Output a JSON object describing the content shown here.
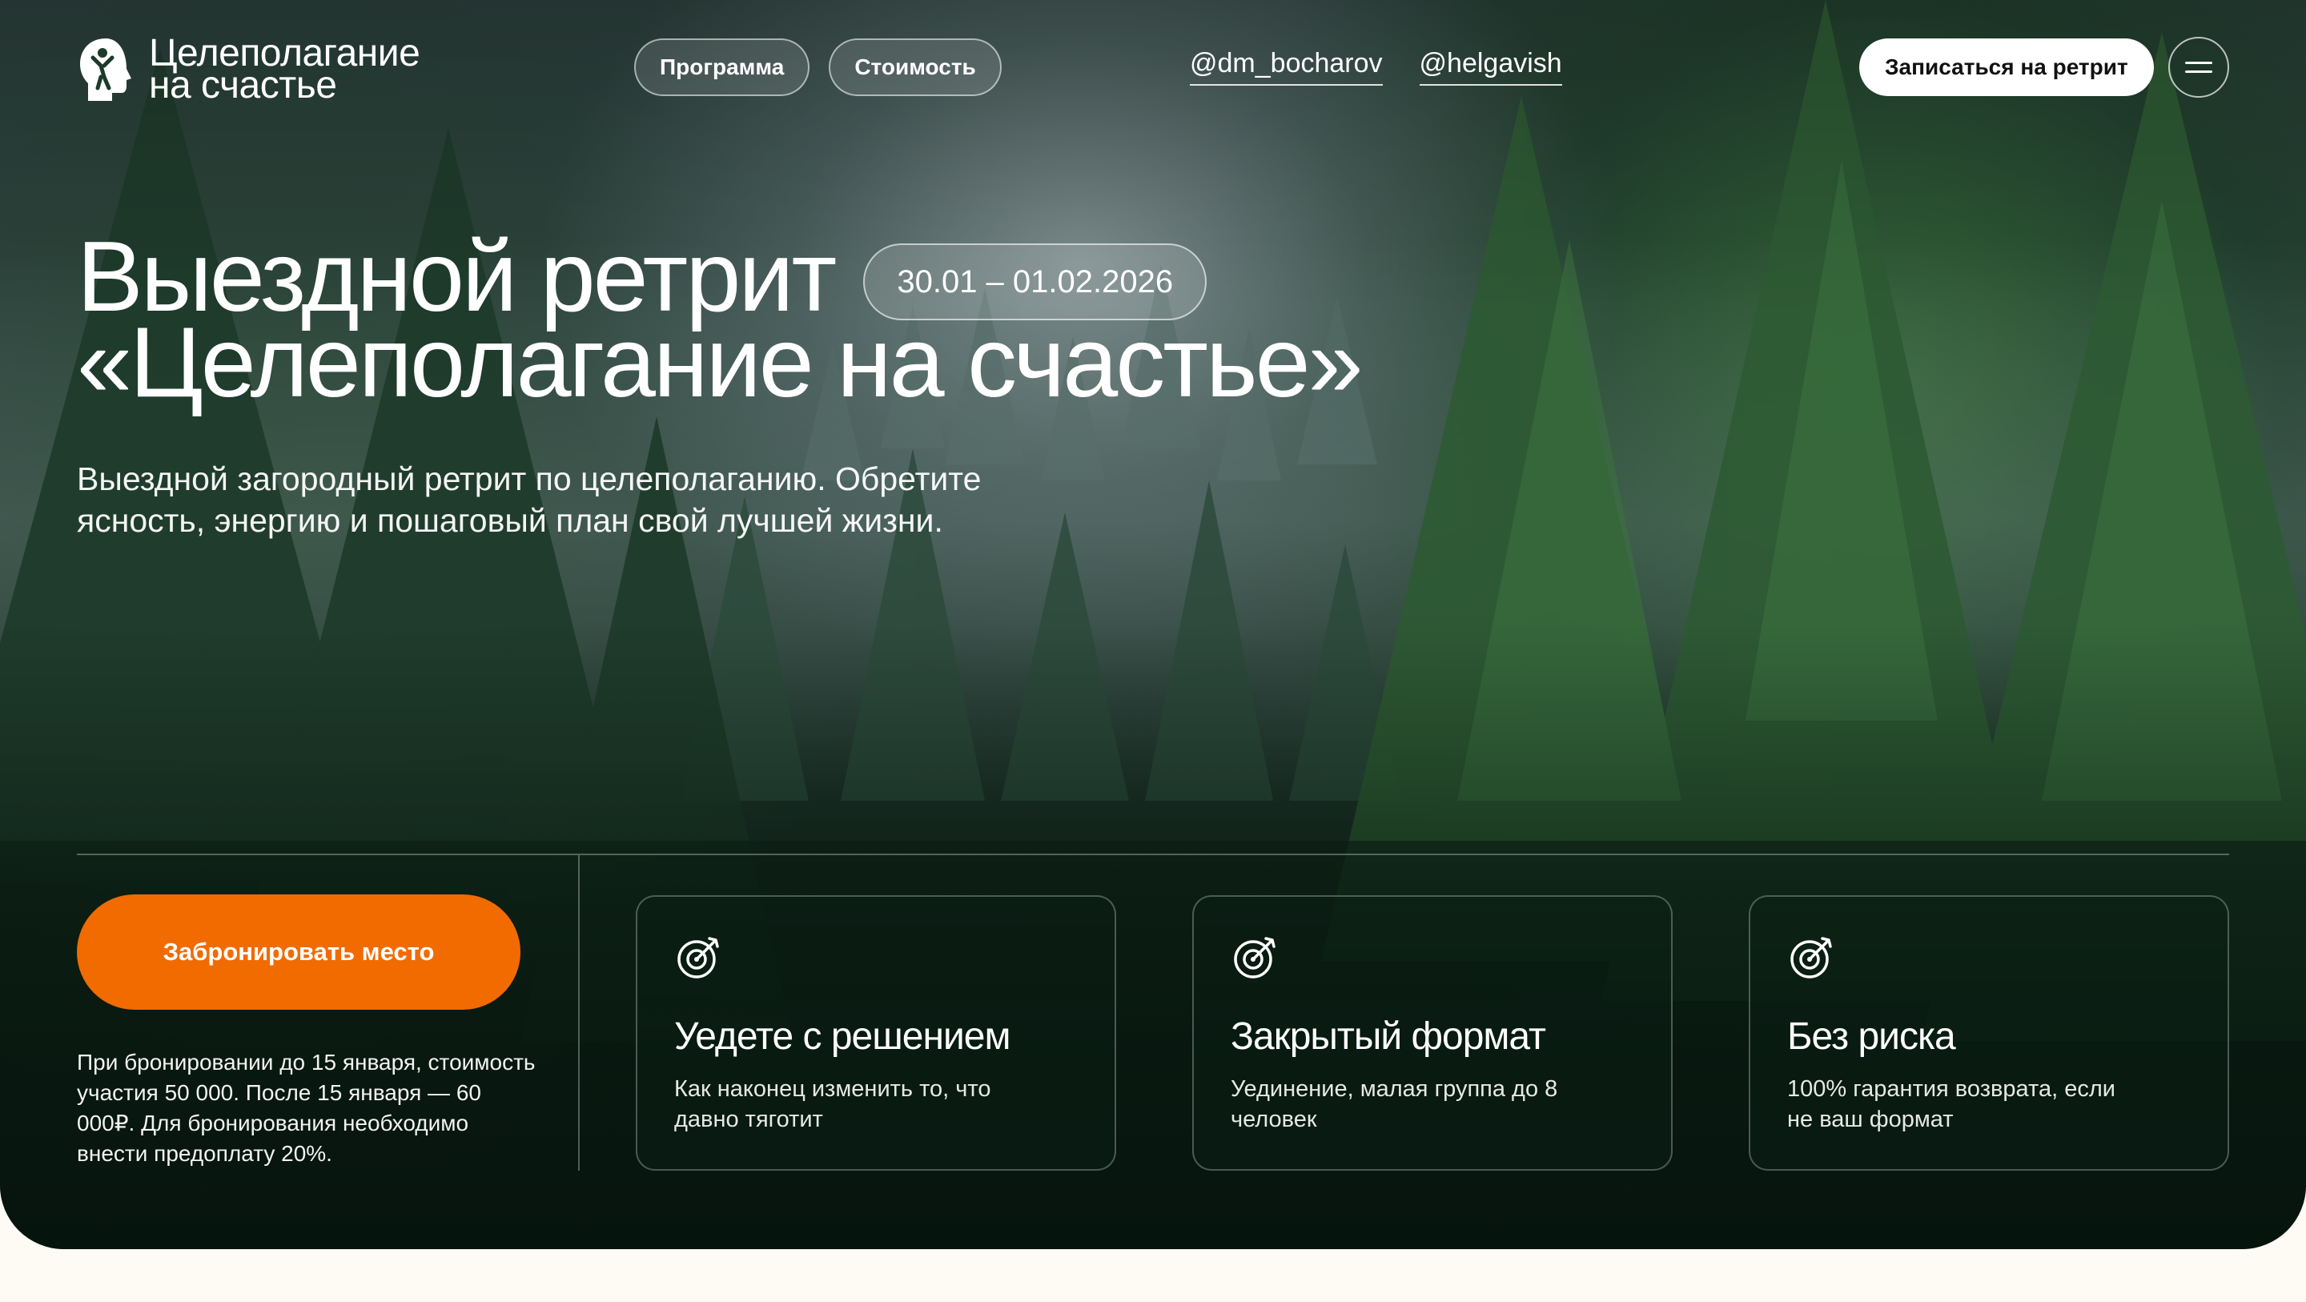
{
  "brand": {
    "line1": "Целеполагание",
    "line2": "на счастье"
  },
  "nav": [
    {
      "label": "Программа"
    },
    {
      "label": "Стоимость"
    }
  ],
  "socials": [
    {
      "label": "@dm_bocharov"
    },
    {
      "label": "@helgavish"
    }
  ],
  "header": {
    "cta_label": "Записаться на ретрит",
    "menu_icon": "menu-icon"
  },
  "hero": {
    "title_line1": "Выездной ретрит",
    "date": "30.01 – 01.02.2026",
    "title_line2": "«Целеполагание на счастье»",
    "subtitle": "Выездной загородный ретрит по целеполаганию. Обретите ясность, энергию и пошаговый план свой лучшей жизни."
  },
  "booking": {
    "button_label": "Забронировать место",
    "note": "При бронировании до 15 января, стоимость участия 50 000. После 15 января — 60 000₽. Для бронирования необходимо внести предоплату 20%."
  },
  "features": [
    {
      "icon": "target-icon",
      "title": "Уедете с решением",
      "text": "Как наконец изменить то, что давно тяготит"
    },
    {
      "icon": "target-icon",
      "title": "Закрытый формат",
      "text": "Уединение, малая группа до 8 человек"
    },
    {
      "icon": "target-icon",
      "title": "Без риска",
      "text": "100% гарантия возврата, если не ваш формат"
    }
  ],
  "colors": {
    "accent": "#f26b00",
    "page_bg": "#fdfbf3",
    "forest": "#1c3a2a"
  }
}
